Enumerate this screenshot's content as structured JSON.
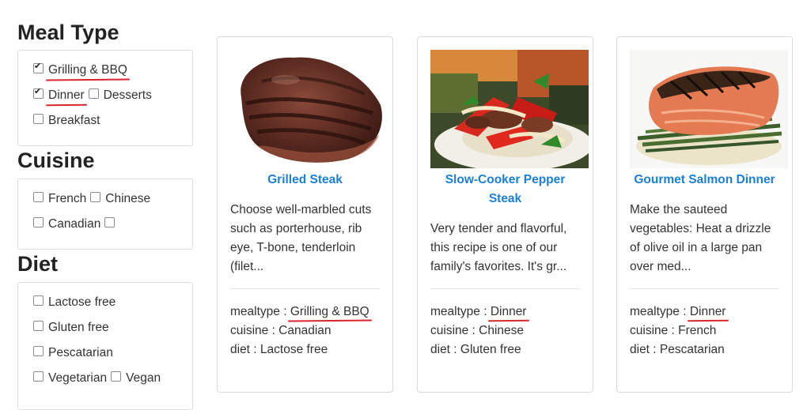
{
  "filters": {
    "meal_type": {
      "heading": "Meal Type",
      "options": [
        {
          "label": "Grilling & BBQ",
          "checked": true
        },
        {
          "label": "Dinner",
          "checked": true
        },
        {
          "label": "Desserts",
          "checked": false
        },
        {
          "label": "Breakfast",
          "checked": false
        }
      ]
    },
    "cuisine": {
      "heading": "Cuisine",
      "options": [
        {
          "label": "French",
          "checked": false
        },
        {
          "label": "Chinese",
          "checked": false
        },
        {
          "label": "Canadian",
          "checked": false
        },
        {
          "label": "",
          "checked": false
        }
      ]
    },
    "diet": {
      "heading": "Diet",
      "options": [
        {
          "label": "Lactose free",
          "checked": false
        },
        {
          "label": "Gluten free",
          "checked": false
        },
        {
          "label": "Pescatarian",
          "checked": false
        },
        {
          "label": "Vegetarian",
          "checked": false
        },
        {
          "label": "Vegan",
          "checked": false
        }
      ]
    }
  },
  "recipes": [
    {
      "title": "Grilled Steak",
      "description": [
        "Choose well-marbled cuts",
        "such as porterhouse, rib",
        "eye, T-bone, tenderloin",
        "(filet..."
      ],
      "mealtype_key": "mealtype : ",
      "mealtype_value": "Grilling & BBQ",
      "cuisine": "cuisine : Canadian",
      "diet": "diet : Lactose free"
    },
    {
      "title_lines": [
        "Slow-Cooker Pepper",
        "Steak"
      ],
      "description": [
        "Very tender and flavorful,",
        "this recipe is one of our",
        "family's favorites. It's gr..."
      ],
      "mealtype_key": "mealtype : ",
      "mealtype_value": "Dinner",
      "cuisine": "cuisine : Chinese",
      "diet": "diet : Gluten free"
    },
    {
      "title": "Gourmet Salmon Dinner",
      "description": [
        "Make the sauteed",
        "vegetables: Heat a drizzle",
        "of olive oil in a large pan",
        "over med..."
      ],
      "mealtype_key": "mealtype : ",
      "mealtype_value": "Dinner",
      "cuisine": "cuisine : French",
      "diet": "diet : Pescatarian"
    }
  ],
  "colors": {
    "title_link": "#1c7fd6",
    "annotation_underline": "#d8262d",
    "card_border": "#d9d9d9"
  }
}
